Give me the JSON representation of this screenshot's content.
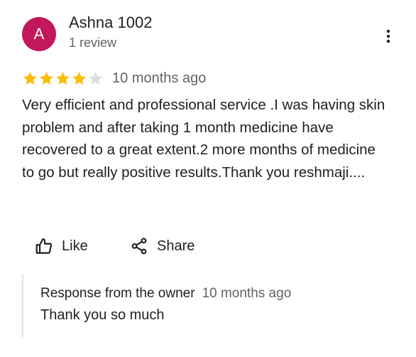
{
  "reviewer": {
    "initial": "A",
    "name": "Ashna 1002",
    "meta": "1 review",
    "avatar_color": "#c2185b"
  },
  "review": {
    "rating": 4,
    "max_rating": 5,
    "date": "10 months ago",
    "text": "Very efficient and professional service .I was having skin problem and after taking 1 month medicine have recovered to a great extent.2 more months of medicine to go but really positive results.Thank you reshmaji....",
    "star_filled_color": "#fbbc04",
    "star_empty_color": "#dadce0"
  },
  "actions": {
    "like_label": "Like",
    "share_label": "Share"
  },
  "owner_response": {
    "label": "Response from the owner",
    "date": "10 months ago",
    "text": "Thank you so much"
  },
  "icons": {
    "more": "more-vert-icon",
    "like": "thumb-up-icon",
    "share": "share-icon",
    "star": "star-icon"
  }
}
